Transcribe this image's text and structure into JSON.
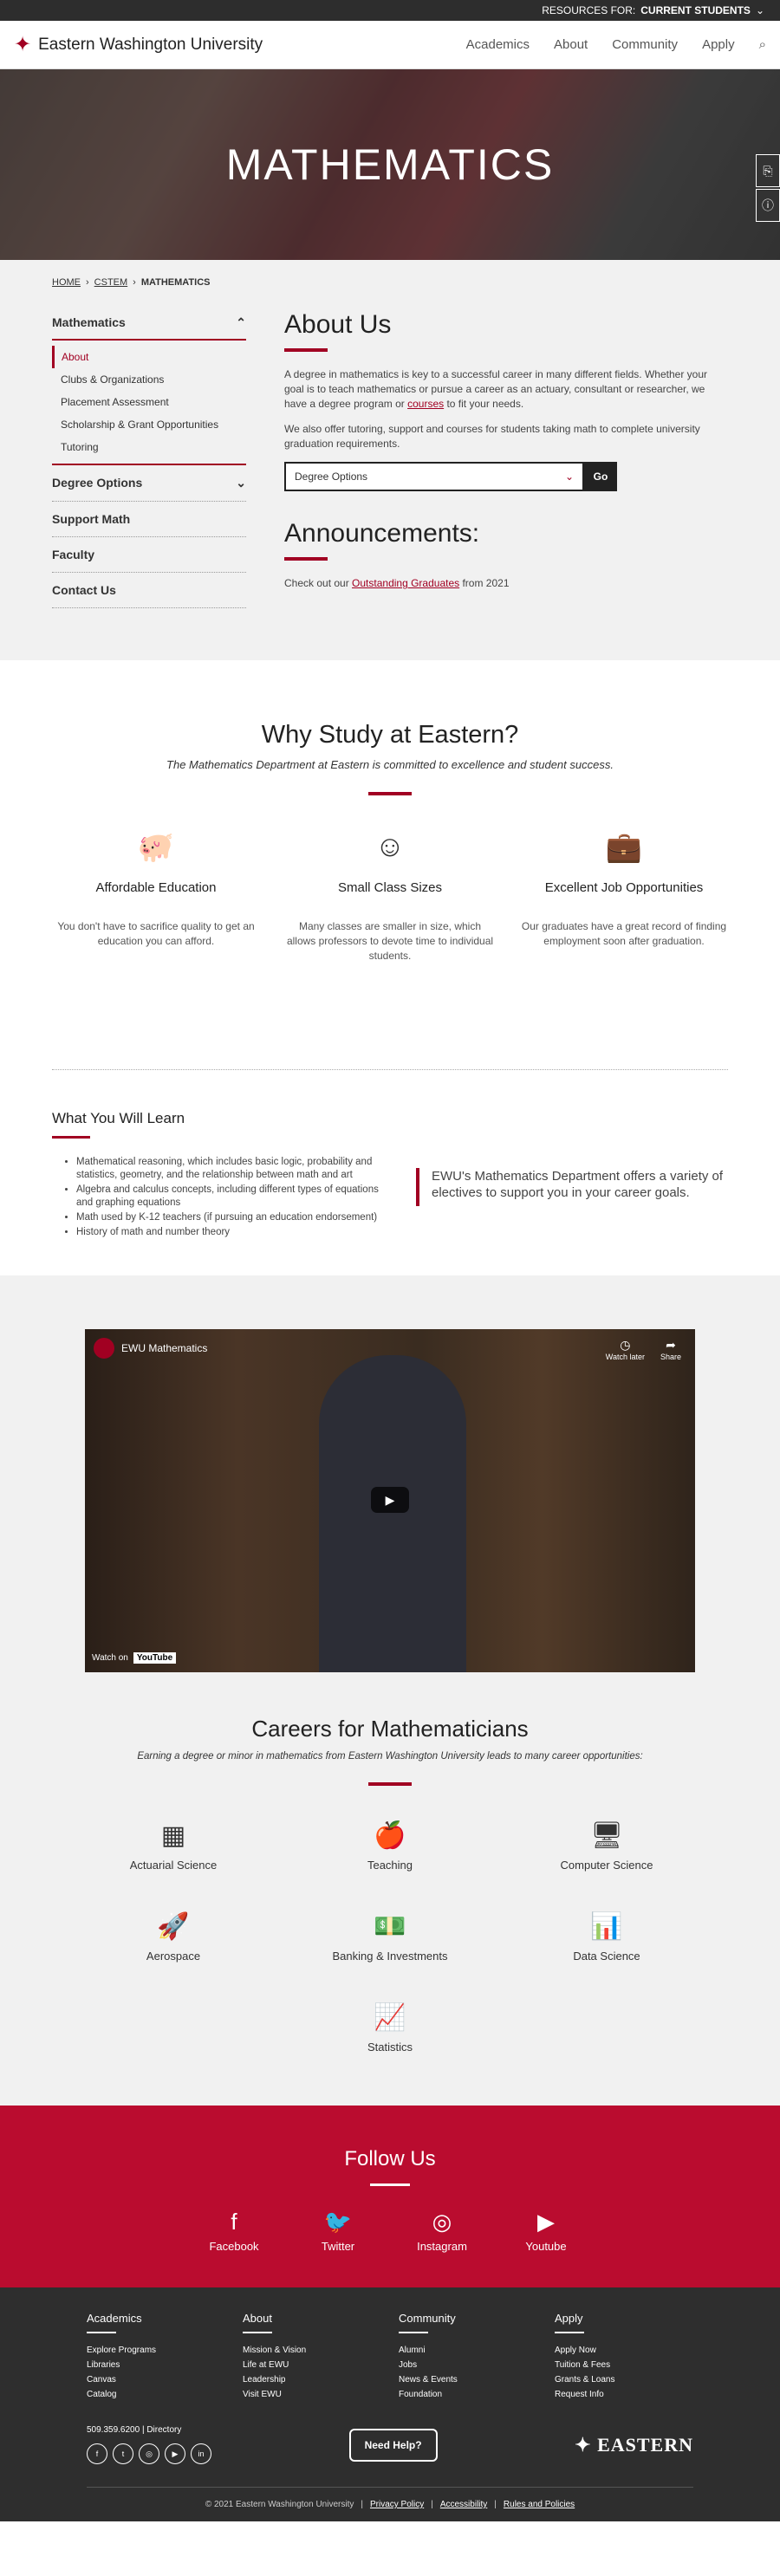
{
  "topbar": {
    "resources_label": "RESOURCES FOR:",
    "audience": "CURRENT STUDENTS"
  },
  "header": {
    "site_name": "Eastern Washington University",
    "nav": [
      "Academics",
      "About",
      "Community",
      "Apply"
    ]
  },
  "hero": {
    "title": "MATHEMATICS"
  },
  "breadcrumb": [
    "HOME",
    "CSTEM",
    "MATHEMATICS"
  ],
  "sidebar": {
    "section": "Mathematics",
    "items": [
      "About",
      "Clubs & Organizations",
      "Placement Assessment",
      "Scholarship & Grant Opportunities",
      "Tutoring"
    ],
    "groups": [
      "Degree Options",
      "Support Math",
      "Faculty",
      "Contact Us"
    ]
  },
  "about": {
    "title": "About Us",
    "p1_a": "A degree in mathematics is key to a successful career in many different fields. Whether your goal is to teach mathematics or pursue a career as an actuary, consultant or researcher, we have a degree program or ",
    "p1_link": "courses",
    "p1_b": " to fit your needs.",
    "p2": "We also offer tutoring, support and courses for students taking math to complete university graduation requirements.",
    "select_value": "Degree Options",
    "go": "Go"
  },
  "announcements": {
    "title": "Announcements:",
    "text_a": "Check out our ",
    "link": "Outstanding Graduates",
    "text_b": " from 2021"
  },
  "why": {
    "title": "Why Study at Eastern?",
    "subtitle": "The Mathematics Department at Eastern is committed to excellence and student success.",
    "cols": [
      {
        "title": "Affordable Education",
        "text": "You don't have to sacrifice quality to get an education you can afford.",
        "icon": "piggy-bank-icon"
      },
      {
        "title": "Small Class Sizes",
        "text": "Many classes are smaller in size, which allows professors to devote time to individual students.",
        "icon": "people-icon"
      },
      {
        "title": "Excellent Job Opportunities",
        "text": "Our graduates have a great record of finding employment soon after graduation.",
        "icon": "briefcase-icon"
      }
    ]
  },
  "learn": {
    "title": "What You Will Learn",
    "items": [
      "Mathematical reasoning, which includes basic logic, probability and statistics, geometry, and the relationship between math and art",
      "Algebra and calculus concepts, including different types of equations and graphing equations",
      "Math used by K-12 teachers (if pursuing an education endorsement)",
      "History of math and number theory"
    ],
    "quote": "EWU's Mathematics Department offers a variety of electives to support you in your career goals."
  },
  "video": {
    "title": "EWU Mathematics",
    "watch_later": "Watch later",
    "share": "Share",
    "watch_on": "Watch on",
    "youtube": "YouTube"
  },
  "careers": {
    "title": "Careers for Mathematicians",
    "subtitle": "Earning a degree or minor in mathematics from Eastern Washington University leads to many career opportunities:",
    "items": [
      "Actuarial Science",
      "Teaching",
      "Computer Science",
      "Aerospace",
      "Banking & Investments",
      "Data Science",
      "Statistics"
    ]
  },
  "follow": {
    "title": "Follow Us",
    "items": [
      "Facebook",
      "Twitter",
      "Instagram",
      "Youtube"
    ]
  },
  "footer": {
    "cols": [
      {
        "title": "Academics",
        "links": [
          "Explore Programs",
          "Libraries",
          "Canvas",
          "Catalog"
        ]
      },
      {
        "title": "About",
        "links": [
          "Mission & Vision",
          "Life at EWU",
          "Leadership",
          "Visit EWU"
        ]
      },
      {
        "title": "Community",
        "links": [
          "Alumni",
          "Jobs",
          "News & Events",
          "Foundation"
        ]
      },
      {
        "title": "Apply",
        "links": [
          "Apply Now",
          "Tuition & Fees",
          "Grants & Loans",
          "Request Info"
        ]
      }
    ],
    "phone": "509.359.6200",
    "directory": "Directory",
    "help": "Need Help?",
    "logo_text": "EASTERN",
    "copyright": "© 2021 Eastern Washington University",
    "privacy": "Privacy Policy",
    "accessibility": "Accessibility",
    "rules": "Rules and Policies"
  },
  "colors": {
    "accent": "#a10022",
    "follow_bg": "#ba0c2f",
    "footer_bg": "#2e2e2e"
  }
}
